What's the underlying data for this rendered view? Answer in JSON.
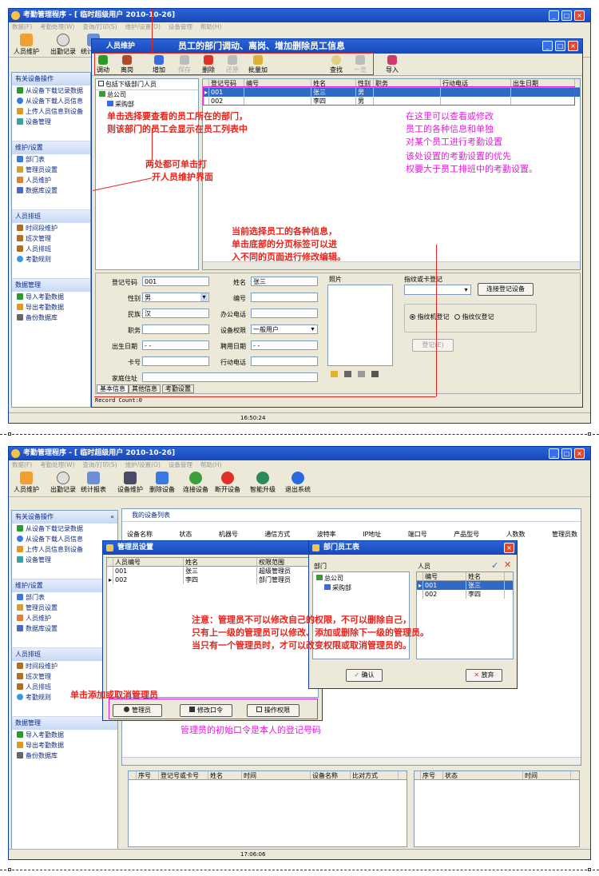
{
  "app": {
    "title": "考勤管理程序 - [ 临时超级用户 2010-10-26]",
    "menu": [
      "数据(F)",
      "考勤处理(W)",
      "查询/打印(S)",
      "维护/设置(O)",
      "设备管理",
      "帮助(H)"
    ]
  },
  "toolbar": {
    "items": [
      "人员维护",
      "出勤记录",
      "统计报表",
      "设备维护",
      "删除设备",
      "连接设备",
      "断开设备",
      "智能升级",
      "退出系统"
    ]
  },
  "sidebar": {
    "groups": [
      {
        "title": "有关设备操作",
        "items": [
          "从设备下载记录数据",
          "从设备下载人员信息",
          "上传人员信息到设备",
          "设备管理"
        ]
      },
      {
        "title": "维护/设置",
        "items": [
          "部门表",
          "管理员设置",
          "人员维护",
          "数据库设置"
        ]
      },
      {
        "title": "人员排班",
        "items": [
          "时间段维护",
          "班次管理",
          "人员排班",
          "考勤规则"
        ]
      },
      {
        "title": "数据管理",
        "items": [
          "导入考勤数据",
          "导出考勤数据",
          "备份数据库"
        ]
      }
    ]
  },
  "top": {
    "dialog_title": "人员维护",
    "heading": "员工的部门调动、离岗、增加删除员工信息",
    "tools": [
      "调动",
      "离岗",
      "增加",
      "保存",
      "删除",
      "还原",
      "批量加",
      "查找",
      "一览",
      "导入"
    ],
    "tree_check": "包括下级部门人员",
    "tree": [
      "总公司",
      "采购部"
    ],
    "columns": [
      "登记号码",
      "编号",
      "姓名",
      "性别",
      "职务",
      "行动电话",
      "出生日期"
    ],
    "rows": [
      [
        "001",
        "",
        "张三",
        "男",
        "",
        "",
        ""
      ],
      [
        "002",
        "",
        "李四",
        "男",
        "",
        "",
        ""
      ]
    ],
    "form": {
      "labels": {
        "reg": "登记号码",
        "name": "姓名",
        "sex": "性别",
        "num": "编号",
        "nation": "民族",
        "officetel": "办公电话",
        "duty": "职务",
        "perm": "设备权限",
        "birth": "出生日期",
        "hire": "聘用日期",
        "card": "卡号",
        "mobile": "行动电话",
        "addr": "家庭住址",
        "photo": "照片",
        "fp": "指纹或卡登记"
      },
      "values": {
        "reg": "001",
        "name": "张三",
        "sex": "男",
        "nation": "汉",
        "perm": "一般用户",
        "birth": " -  - ",
        "hire": " -  - "
      },
      "connect": "连接登记设备",
      "fp_machine": "指纹机登记",
      "fp_reader": "指纹仪登记",
      "enroll": "登记(E)"
    },
    "tabs": [
      "基本信息",
      "其他信息",
      "考勤设置"
    ],
    "record_count": "Record Count:0",
    "time": "16:50:24",
    "annotations": {
      "a1": "单击选择要查看的员工所在的部门，",
      "a2": "则该部门的员工会显示在员工列表中",
      "a3": "两处都可单击打",
      "a4": "开人员维护界面",
      "a5": "在这里可以查看或修改",
      "a6": "员工的各种信息和单独",
      "a7": "对某个员工进行考勤设置",
      "a8": "该处设置的考勤设置的优先",
      "a9": "权要大于员工排班中的考勤设置。",
      "a10": "当前选择员工的各种信息，",
      "a11": "单击底部的分页标签可以进",
      "a12": "入不同的页面进行修改编辑。"
    }
  },
  "bottom": {
    "panel_title": "我的设备列表",
    "dev_columns": [
      "设备名称",
      "状态",
      "机器号",
      "通信方式",
      "波特率",
      "IP地址",
      "端口号",
      "产品型号",
      "人数数",
      "管理员数"
    ],
    "admin_title": "管理员设置",
    "admin_columns": [
      "人员编号",
      "姓名",
      "权限范围"
    ],
    "admin_rows": [
      [
        "001",
        "张三",
        "超级管理员"
      ],
      [
        "002",
        "李四",
        "部门管理员"
      ]
    ],
    "admin_buttons": [
      "管理员",
      "修改口令",
      "操作权限"
    ],
    "emp_title": "部门员工表",
    "emp_dept": "部门",
    "emp_people": "人员",
    "emp_tree": [
      "总公司",
      "采购部"
    ],
    "emp_columns": [
      "编号",
      "姓名"
    ],
    "emp_rows": [
      [
        "001",
        "张三"
      ],
      [
        "002",
        "李四"
      ]
    ],
    "ok": "确认",
    "cancel": "放弃",
    "log_columns": [
      "序号",
      "登记号或卡号",
      "姓名",
      "时间",
      "设备名称",
      "比对方式"
    ],
    "log2_columns": [
      "序号",
      "状态",
      "时间"
    ],
    "time": "17:06:06",
    "annotations": {
      "n1": "注意：管理员不可以修改自己的权限，不可以删除自己，",
      "n2": "只有上一级的管理员可以修改、添加或删除下一级的管理员。",
      "n3": "当只有一个管理员时，才可以改变权限或取消管理员的。",
      "n4": "单击添加或取消管理员",
      "n5": "管理员的初始口令是本人的登记号码"
    }
  }
}
